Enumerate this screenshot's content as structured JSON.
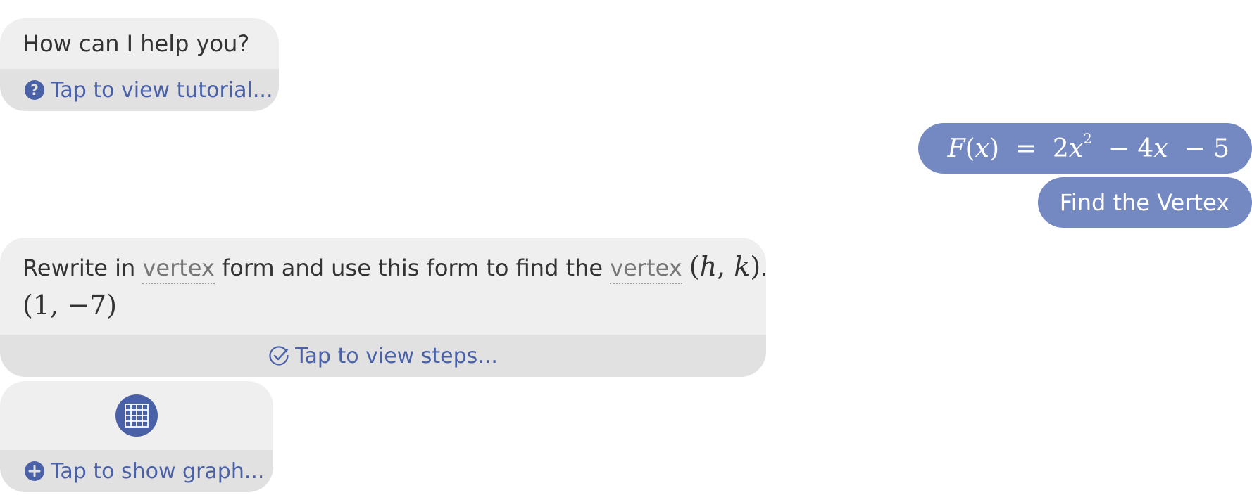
{
  "greeting": {
    "text": "How can I help you?",
    "tutorial_link": "Tap to view tutorial...",
    "help_icon": "question-circle-icon"
  },
  "user_input": {
    "equation_lhs_fn": "F",
    "equation_lhs_var": "x",
    "equation_rhs_coef_a": "2",
    "equation_rhs_var": "x",
    "equation_rhs_exp": "2",
    "equation_rhs_rest": "− 4",
    "equation_rhs_var2": "x",
    "equation_rhs_const": "− 5",
    "action": "Find the Vertex"
  },
  "answer": {
    "part1": "Rewrite in ",
    "term1": "vertex",
    "part2": " form and use this form to find the ",
    "term2": "vertex",
    "point_h": "h",
    "point_k": "k",
    "period": ".",
    "result_x": "1",
    "result_y": "−7",
    "steps_link": "Tap to view steps...",
    "steps_icon": "check-circle-icon"
  },
  "graph": {
    "icon": "grid-graph-icon",
    "link": "Tap to show graph...",
    "link_icon": "plus-circle-icon"
  },
  "colors": {
    "accent": "#4a61a8",
    "user_bubble": "#7488c1",
    "bubble_bg": "#efefef",
    "bubble_footer": "#e1e1e1"
  }
}
